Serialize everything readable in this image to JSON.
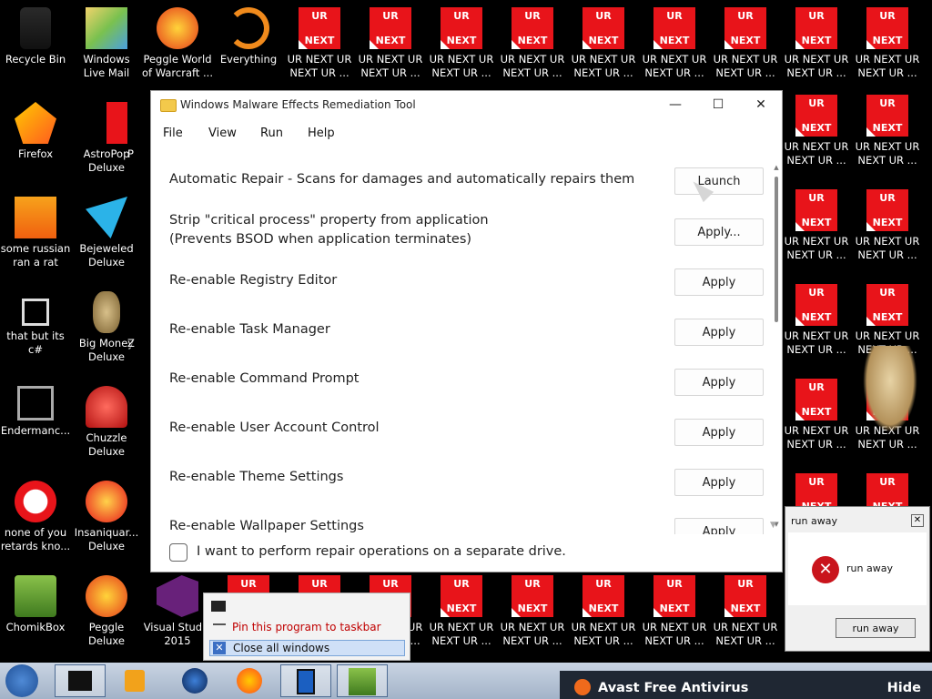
{
  "desktop": {
    "icons": [
      {
        "label": "Recycle Bin",
        "icon": "recycle-bin-icon"
      },
      {
        "label": "Windows Live Mail",
        "icon": "mail-icon"
      },
      {
        "label": "Peggle World of Warcraft ...",
        "icon": "peggle-icon"
      },
      {
        "label": "Everything",
        "icon": "search-icon"
      },
      {
        "label": "Firefox",
        "icon": "firefox-icon"
      },
      {
        "label": "AstroPop Deluxe",
        "icon": "game-icon"
      },
      {
        "label": "some russian ran a rat",
        "icon": "app-icon"
      },
      {
        "label": "Bejeweled Deluxe",
        "icon": "gem-icon"
      },
      {
        "label": "that but its c#",
        "icon": "app-icon"
      },
      {
        "label": "Big Money Deluxe",
        "icon": "game-icon"
      },
      {
        "label": "Endermanc...",
        "icon": "app-icon"
      },
      {
        "label": "Chuzzle Deluxe",
        "icon": "game-icon"
      },
      {
        "label": "none of you retards kno...",
        "icon": "app-icon"
      },
      {
        "label": "Insaniquar... Deluxe",
        "icon": "fish-icon"
      },
      {
        "label": "ChomikBox",
        "icon": "hamster-icon"
      },
      {
        "label": "Peggle Deluxe",
        "icon": "peggle-icon"
      },
      {
        "label": "Visual Studio 2015",
        "icon": "visual-studio-icon"
      }
    ],
    "partial_labels": [
      "P",
      "Z"
    ],
    "ur_box_top": "UR",
    "ur_box_bottom": "NEXT",
    "ur_label": "UR NEXT UR NEXT UR ..."
  },
  "window": {
    "title": "Windows Malware Effects Remediation Tool",
    "controls": {
      "minimize": "—",
      "maximize": "☐",
      "close": "✕"
    },
    "menu": [
      "File",
      "View",
      "Run",
      "Help"
    ],
    "rows": [
      {
        "label": "Automatic Repair - Scans for damages and automatically repairs them",
        "button": "Launch"
      },
      {
        "label": "Strip \"critical process\" property from application",
        "label2": "(Prevents BSOD when application terminates)",
        "button": "Apply..."
      },
      {
        "label": "Re-enable Registry Editor",
        "button": "Apply"
      },
      {
        "label": "Re-enable Task Manager",
        "button": "Apply"
      },
      {
        "label": "Re-enable Command Prompt",
        "button": "Apply"
      },
      {
        "label": "Re-enable User Account Control",
        "button": "Apply"
      },
      {
        "label": "Re-enable Theme Settings",
        "button": "Apply"
      },
      {
        "label": "Re-enable Wallpaper Settings",
        "button": "Apply"
      }
    ],
    "separate_drive": "I want to perform repair operations on a separate drive."
  },
  "context_menu": {
    "pin": "Pin this program to taskbar",
    "close_all": "Close all windows"
  },
  "dialog": {
    "title": "run away",
    "message": "run away",
    "button": "run away",
    "close": "✕"
  },
  "tray": {
    "avast": "Avast Free Antivirus",
    "hide": "Hide"
  }
}
